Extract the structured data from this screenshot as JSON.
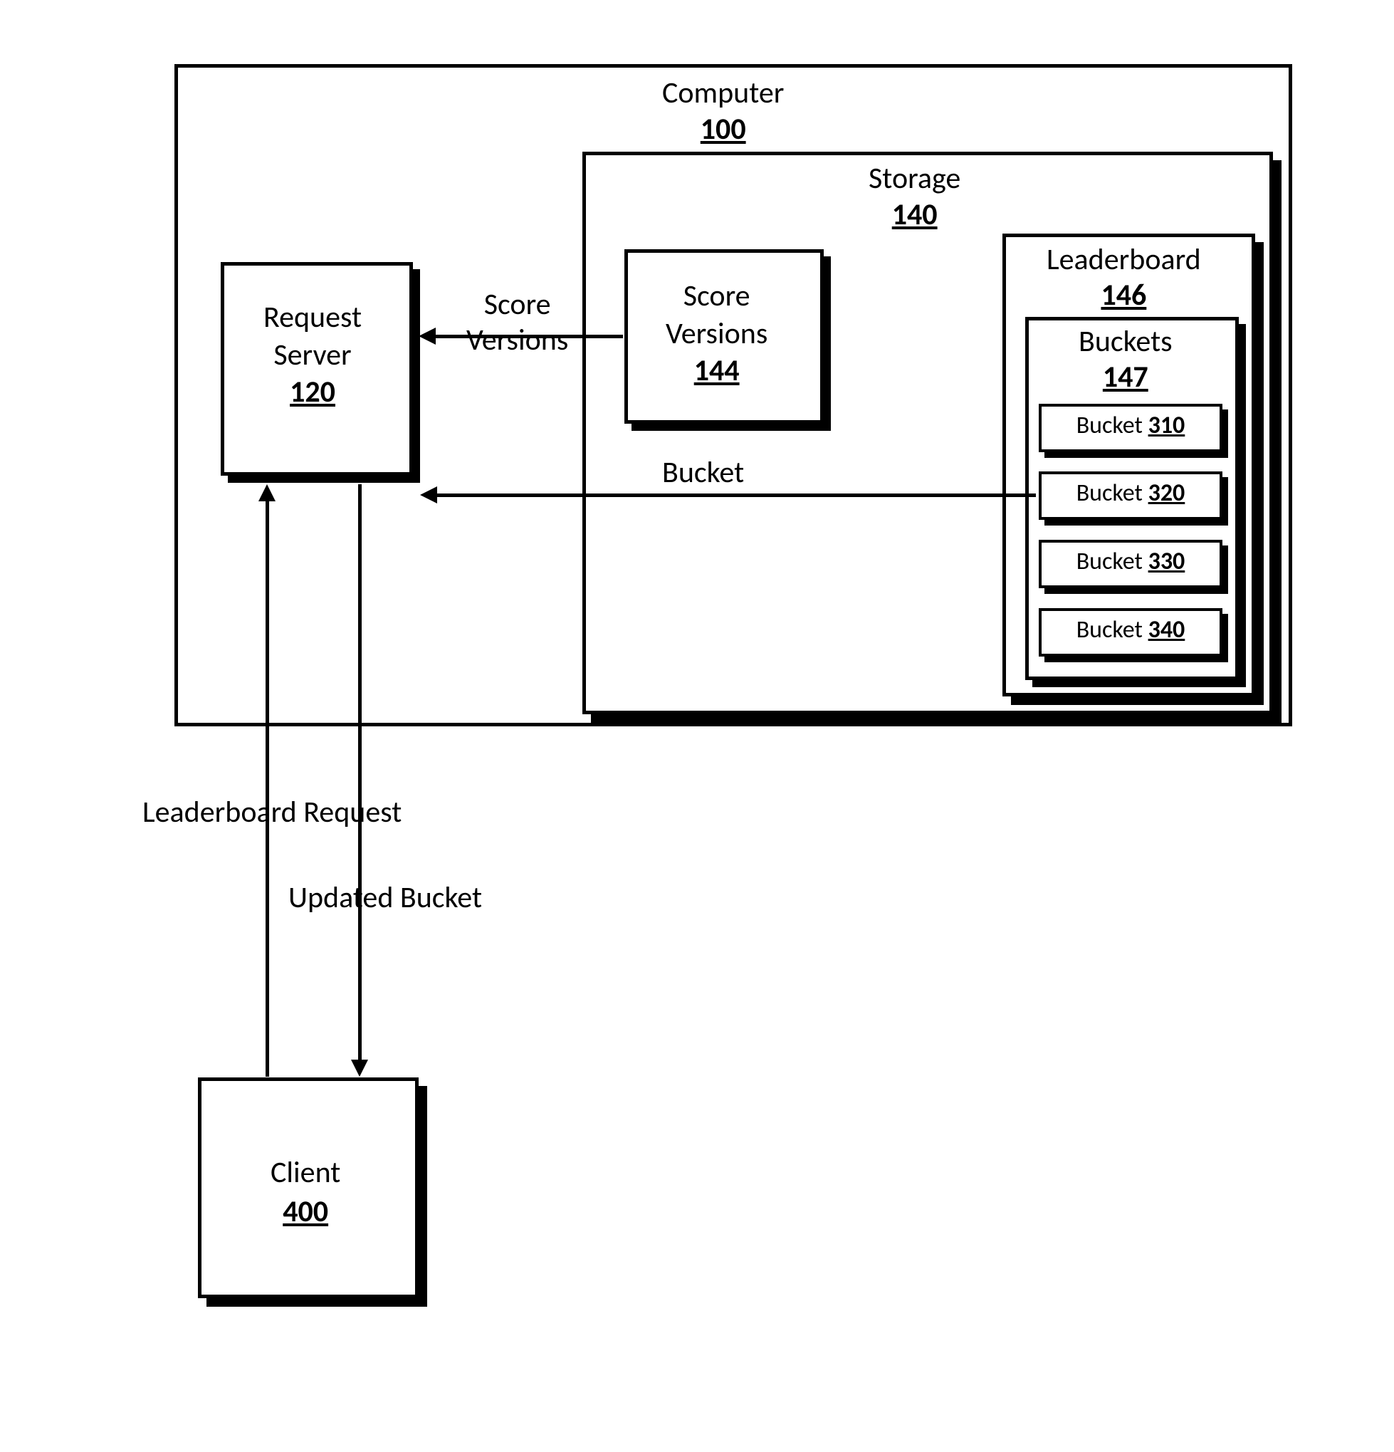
{
  "computer": {
    "label": "Computer",
    "num": "100"
  },
  "storage": {
    "label": "Storage",
    "num": "140"
  },
  "requestServer": {
    "label1": "Request",
    "label2": "Server",
    "num": "120"
  },
  "scoreVersions": {
    "label1": "Score",
    "label2": "Versions",
    "num": "144"
  },
  "leaderboard": {
    "label": "Leaderboard",
    "num": "146"
  },
  "bucketsGroup": {
    "label": "Buckets",
    "num": "147"
  },
  "buckets": [
    {
      "label": "Bucket",
      "num": "310"
    },
    {
      "label": "Bucket",
      "num": "320"
    },
    {
      "label": "Bucket",
      "num": "330"
    },
    {
      "label": "Bucket",
      "num": "340"
    }
  ],
  "client": {
    "label": "Client",
    "num": "400"
  },
  "arrows": {
    "scoreVersions": {
      "label1": "Score",
      "label2": "Versions"
    },
    "bucket": "Bucket",
    "leaderboardRequest": "Leaderboard Request",
    "updatedBucket": "Updated Bucket"
  }
}
